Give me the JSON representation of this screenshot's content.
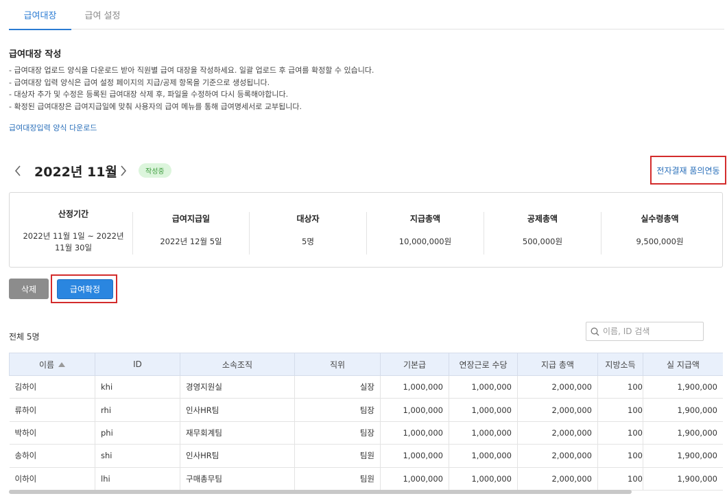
{
  "tabs": [
    {
      "label": "급여대장",
      "active": true
    },
    {
      "label": "급여 설정",
      "active": false
    }
  ],
  "section": {
    "title": "급여대장 작성",
    "descriptions": [
      "- 급여대장 업로드 양식을 다운로드 받아 직원별 급여 대장을 작성하세요. 일괄 업로드 후 급여를 확정할 수 있습니다.",
      "- 급여대장 입력 양식은 급여 설정 페이지의 지급/공제 항목을 기준으로 생성됩니다.",
      "- 대상자 추가 및 수정은 등록된 급여대장 삭제 후, 파일을 수정하여 다시 등록해야합니다.",
      "- 확정된 급여대장은 급여지급일에 맞춰 사용자의 급여 메뉴를 통해 급여명세서로 교부됩니다."
    ],
    "download_link": "급여대장입력 양식 다운로드"
  },
  "period": {
    "title": "2022년 11월",
    "status": "작성중",
    "approval_link": "전자결재 품의연동"
  },
  "summary": [
    {
      "label": "산정기간",
      "value": "2022년 11월 1일 ~ 2022년 11월 30일"
    },
    {
      "label": "급여지급일",
      "value": "2022년 12월 5일"
    },
    {
      "label": "대상자",
      "value": "5명"
    },
    {
      "label": "지급총액",
      "value": "10,000,000원"
    },
    {
      "label": "공제총액",
      "value": "500,000원"
    },
    {
      "label": "실수령총액",
      "value": "9,500,000원"
    }
  ],
  "buttons": {
    "delete": "삭제",
    "confirm": "급여확정"
  },
  "list": {
    "total": "전체 5명",
    "search_placeholder": "이름, ID 검색"
  },
  "table": {
    "headers": [
      "이름",
      "ID",
      "소속조직",
      "직위",
      "기본급",
      "연장근로 수당",
      "지급 총액",
      "지방소득",
      "실 지급액"
    ],
    "rows": [
      [
        "김하이",
        "khi",
        "경영지원실",
        "실장",
        "1,000,000",
        "1,000,000",
        "2,000,000",
        "100",
        "1,900,000"
      ],
      [
        "류하이",
        "rhi",
        "인사HR팀",
        "팀장",
        "1,000,000",
        "1,000,000",
        "2,000,000",
        "100",
        "1,900,000"
      ],
      [
        "박하이",
        "phi",
        "재무회계팀",
        "팀장",
        "1,000,000",
        "1,000,000",
        "2,000,000",
        "100",
        "1,900,000"
      ],
      [
        "송하이",
        "shi",
        "인사HR팀",
        "팀원",
        "1,000,000",
        "1,000,000",
        "2,000,000",
        "100",
        "1,900,000"
      ],
      [
        "이하이",
        "lhi",
        "구매총무팀",
        "팀원",
        "1,000,000",
        "1,000,000",
        "2,000,000",
        "100",
        "1,900,000"
      ]
    ]
  },
  "colors": {
    "accent": "#2a7bd3",
    "confirm_button": "#2a86e0",
    "delete_button": "#8c8c8c",
    "highlight_box": "#d32b2b",
    "status_badge_bg": "#dcf5dc",
    "header_bg": "#e9f0fb"
  },
  "icons": {
    "prev": "chevron-left-icon",
    "next": "chevron-right-icon",
    "search": "search-icon",
    "sort": "sort-asc-icon"
  }
}
